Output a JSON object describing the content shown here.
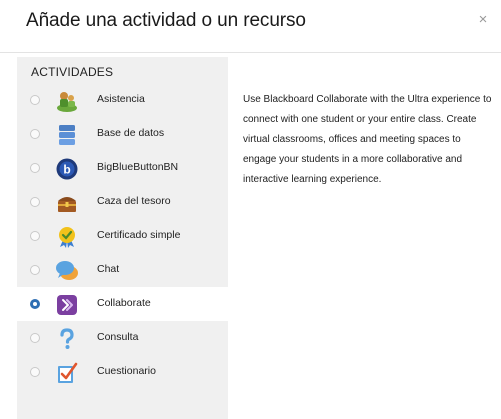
{
  "dialog": {
    "title": "Añade una actividad o un recurso",
    "close_label": "×"
  },
  "activities": {
    "section_label": "ACTIVIDADES",
    "items": [
      {
        "label": "Asistencia",
        "icon": "attendance-icon",
        "selected": false
      },
      {
        "label": "Base de datos",
        "icon": "database-icon",
        "selected": false
      },
      {
        "label": "BigBlueButtonBN",
        "icon": "bigbluebutton-icon",
        "selected": false
      },
      {
        "label": "Caza del tesoro",
        "icon": "treasure-chest-icon",
        "selected": false
      },
      {
        "label": "Certificado simple",
        "icon": "certificate-icon",
        "selected": false
      },
      {
        "label": "Chat",
        "icon": "chat-icon",
        "selected": false
      },
      {
        "label": "Collaborate",
        "icon": "collaborate-icon",
        "selected": true
      },
      {
        "label": "Consulta",
        "icon": "question-icon",
        "selected": false
      },
      {
        "label": "Cuestionario",
        "icon": "quiz-icon",
        "selected": false
      }
    ]
  },
  "description": {
    "text": "Use Blackboard Collaborate with the Ultra experience to connect with one student or your entire class. Create virtual classrooms, offices and meeting spaces to engage your students in a more collaborative and interactive learning experience."
  },
  "colors": {
    "panel_bg": "#f0f0f0",
    "radio_checked": "#2f6fb3",
    "collaborate_purple": "#7b3fa0"
  }
}
